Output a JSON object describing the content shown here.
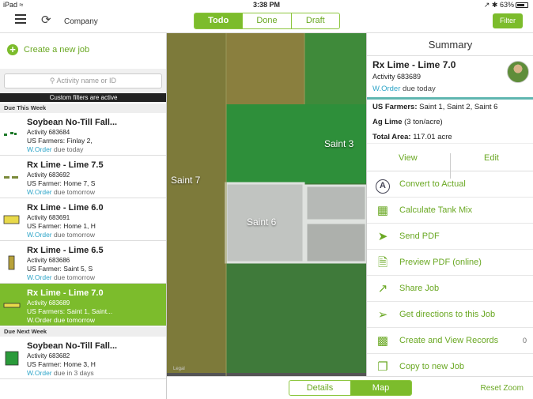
{
  "status": {
    "device": "iPad",
    "time": "3:38 PM",
    "battery": "63%"
  },
  "topbar": {
    "company": "Company",
    "tabs": [
      {
        "label": "Todo",
        "active": true
      },
      {
        "label": "Done",
        "active": false
      },
      {
        "label": "Draft",
        "active": false
      }
    ],
    "filter_label": "Filter"
  },
  "sidebar": {
    "create_label": "Create a new job",
    "search_placeholder": "Activity name or ID",
    "filters_notice": "Custom filters are active",
    "sections": {
      "this_week": "Due This Week",
      "next_week": "Due Next Week"
    },
    "jobs": [
      {
        "title": "Soybean No-Till Fall...",
        "activity": "Activity 683684",
        "farmers": "US Farmers: Finlay 2,",
        "type": "W.Order",
        "due": "due today"
      },
      {
        "title": "Rx Lime - Lime 7.5",
        "activity": "Activity 683692",
        "farmers": "US Farmer: Home 7, S",
        "type": "W.Order",
        "due": "due tomorrow"
      },
      {
        "title": "Rx Lime - Lime 6.0",
        "activity": "Activity 683691",
        "farmers": "US Farmer: Home 1, H",
        "type": "W.Order",
        "due": "due tomorrow"
      },
      {
        "title": "Rx Lime - Lime 6.5",
        "activity": "Activity 683686",
        "farmers": "US Farmer: Saint 5, S",
        "type": "W.Order",
        "due": "due tomorrow"
      },
      {
        "title": "Rx Lime - Lime 7.0",
        "activity": "Activity 683689",
        "farmers": "US Farmers: Saint 1, Saint...",
        "type": "W.Order",
        "due": "due tomorrow"
      },
      {
        "title": "Soybean No-Till Fall...",
        "activity": "Activity 683682",
        "farmers": "US Farmer: Home 3, H",
        "type": "W.Order",
        "due": "due in 3 days"
      }
    ]
  },
  "map": {
    "fields": {
      "saint7": "Saint 7",
      "saint6": "Saint 6",
      "saint3": "Saint 3"
    },
    "attribution": "Legal"
  },
  "bottombar": {
    "tabs": [
      {
        "label": "Details",
        "active": false
      },
      {
        "label": "Map",
        "active": true
      }
    ],
    "reset_zoom": "Reset Zoom"
  },
  "summary": {
    "title": "Summary",
    "job_title": "Rx Lime - Lime 7.0",
    "activity": "Activity 683689",
    "type": "W.Order",
    "due": "due today",
    "farmers_label": "US Farmers:",
    "farmers_value": "Saint 1, Saint 2, Saint 6",
    "product_label": "Ag Lime",
    "product_value": "(3 ton/acre)",
    "area_label": "Total Area:",
    "area_value": "117.01 acre",
    "view_label": "View",
    "edit_label": "Edit",
    "actions": [
      {
        "label": "Convert to Actual",
        "icon": "convert-icon"
      },
      {
        "label": "Calculate Tank Mix",
        "icon": "calculator-icon"
      },
      {
        "label": "Send PDF",
        "icon": "send-icon"
      },
      {
        "label": "Preview PDF (online)",
        "icon": "pdf-preview-icon"
      },
      {
        "label": "Share Job",
        "icon": "share-icon"
      },
      {
        "label": "Get directions to this Job",
        "icon": "directions-icon"
      },
      {
        "label": "Create and View Records",
        "icon": "records-icon",
        "count": "0"
      },
      {
        "label": "Copy to new Job",
        "icon": "copy-icon"
      }
    ]
  },
  "colors": {
    "accent": "#7cbc2c",
    "link": "#2ea5c8",
    "teal": "#5fb6b0"
  }
}
